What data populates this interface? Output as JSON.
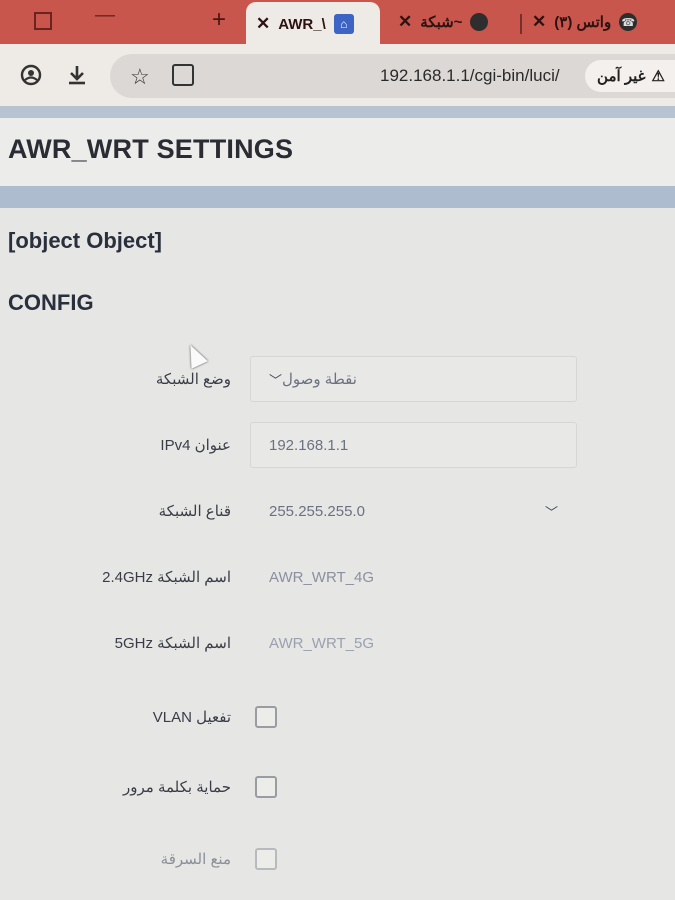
{
  "browser": {
    "tabs": [
      {
        "title": "AWR_\\",
        "active": true,
        "favicon": "router-icon"
      },
      {
        "title": "شبكة~",
        "active": false,
        "favicon": "globe-icon"
      },
      {
        "title": "(٣) واتس",
        "active": false,
        "favicon": "whatsapp-icon"
      }
    ],
    "new_tab_label": "+",
    "address": {
      "url": "192.168.1.1/cgi-bin/luci/",
      "security_label": "غير آمن"
    }
  },
  "page": {
    "title": "AWR_WRT SETTINGS",
    "section_title": "[object Object]",
    "subsection_title": "CONFIG"
  },
  "form": {
    "network_mode": {
      "label": "وضع الشبكة",
      "value": "نقطة وصول"
    },
    "ipv4": {
      "label": "عنوان IPv4",
      "value": "192.168.1.1"
    },
    "netmask": {
      "label": "قناع الشبكة",
      "value": "255.255.255.0"
    },
    "ssid_24": {
      "label": "اسم الشبكة 2.4GHz",
      "placeholder": "AWR_WRT_4G"
    },
    "ssid_5": {
      "label": "اسم الشبكة 5GHz",
      "placeholder": "AWR_WRT_5G"
    },
    "vlan": {
      "label": "تفعيل VLAN",
      "checked": false
    },
    "password_protect": {
      "label": "حماية بكلمة مرور",
      "checked": false
    },
    "anti_theft": {
      "label": "منع السرقة",
      "checked": false
    }
  },
  "colors": {
    "tabstrip": "#c9564d",
    "header_band": "#adbccf",
    "page_bg": "#e6e6e4"
  }
}
